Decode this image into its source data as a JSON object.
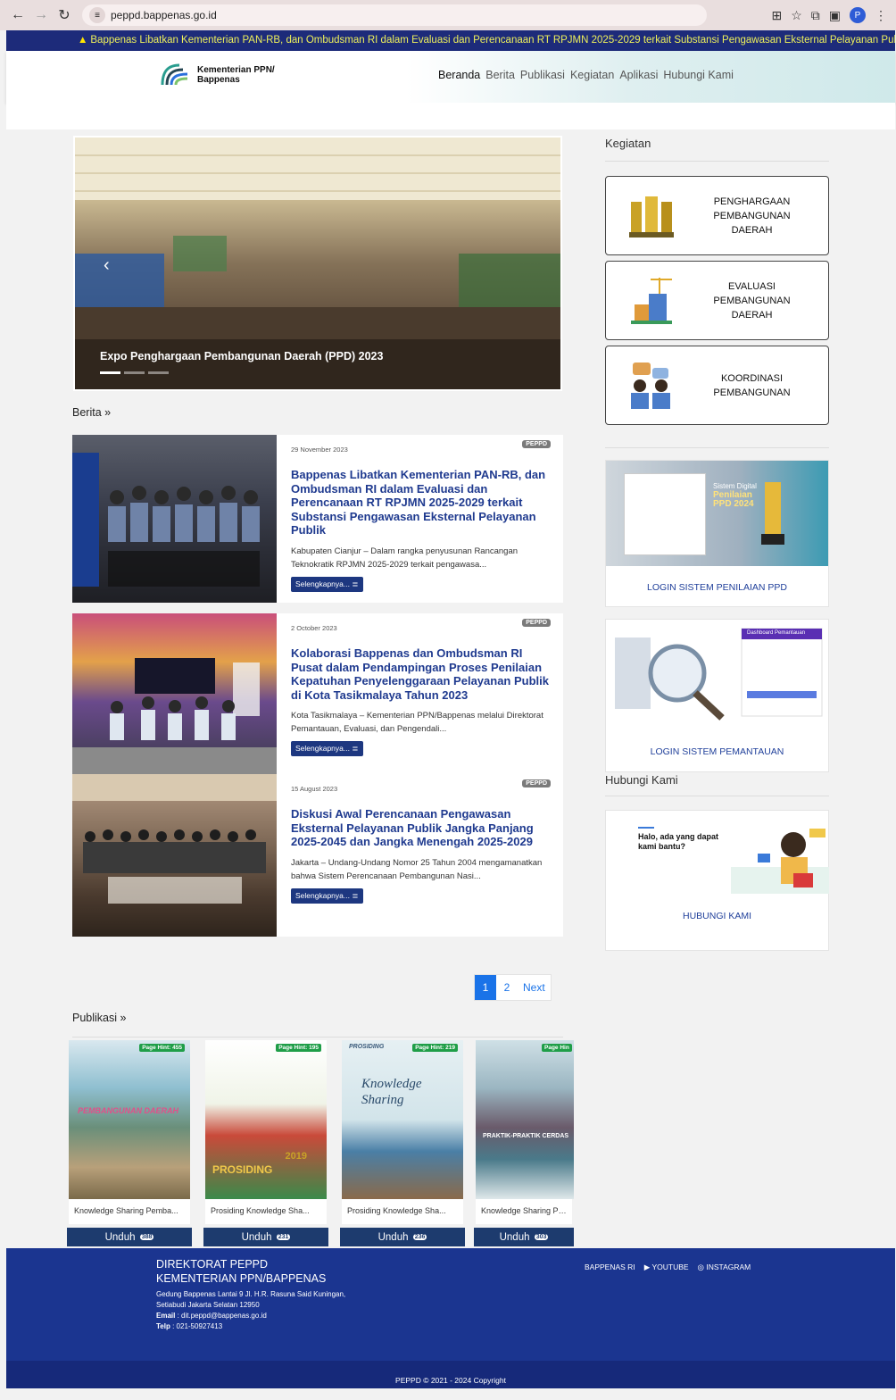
{
  "browser": {
    "url": "peppd.bappenas.go.id"
  },
  "ticker": {
    "text": "Bappenas Libatkan Kementerian PAN-RB, dan Ombudsman RI dalam Evaluasi dan Perencanaan RT RPJMN 2025-2029 terkait Substansi Pengawasan Eksternal Pelayanan Publik"
  },
  "header": {
    "logo_line1": "Kementerian PPN/",
    "logo_line2": "Bappenas",
    "menu": [
      "Beranda",
      "Berita",
      "Publikasi",
      "Kegiatan",
      "Aplikasi",
      "Hubungi Kami"
    ]
  },
  "carousel": {
    "caption": "Expo Penghargaan Pembangunan Daerah (PPD) 2023",
    "slides": 3,
    "active": 1
  },
  "berita": {
    "heading": "Berita »",
    "items": [
      {
        "date": "29 November 2023",
        "tag": "PEPPD",
        "title": "Bappenas Libatkan Kementerian PAN-RB, dan Ombudsman RI dalam Evaluasi dan Perencanaan RT RPJMN 2025-2029 terkait Substansi Pengawasan Eksternal Pelayanan Publik",
        "excerpt": "Kabupaten Cianjur – Dalam rangka penyusunan Rancangan Teknokratik RPJMN 2025-2029 terkait pengawasa...",
        "more": "Selengkapnya..."
      },
      {
        "date": "2 October 2023",
        "tag": "PEPPD",
        "title": "Kolaborasi Bappenas dan Ombudsman RI Pusat dalam Pendampingan Proses Penilaian Kepatuhan Penyelenggaraan Pelayanan Publik di Kota Tasikmalaya Tahun 2023",
        "excerpt": "Kota Tasikmalaya – Kementerian PPN/Bappenas melalui Direktorat Pemantauan, Evaluasi, dan Pengendali...",
        "more": "Selengkapnya..."
      },
      {
        "date": "15 August 2023",
        "tag": "PEPPD",
        "title": "Diskusi Awal Perencanaan Pengawasan Eksternal Pelayanan Publik Jangka Panjang 2025-2045 dan Jangka Menengah 2025-2029",
        "excerpt": "Jakarta – Undang-Undang Nomor 25 Tahun 2004 mengamanatkan bahwa Sistem Perencanaan Pembangunan Nasi...",
        "more": "Selengkapnya..."
      }
    ],
    "pagination": [
      "1",
      "2",
      "Next"
    ]
  },
  "kegiatan": {
    "heading": "Kegiatan",
    "cards": [
      {
        "line1": "PENGHARGAAN",
        "line2": "PEMBANGUNAN",
        "line3": "DAERAH"
      },
      {
        "line1": "EVALUASI",
        "line2": "PEMBANGUNAN",
        "line3": "DAERAH"
      },
      {
        "line1": "KOORDINASI",
        "line2": "PEMBANGUNAN",
        "line3": ""
      }
    ]
  },
  "aplikasi": {
    "login_ppd": "LOGIN SISTEM PENILAIAN PPD",
    "login_ppd_banner_1": "Sistem Digital",
    "login_ppd_banner_2": "Penilaian",
    "login_ppd_banner_3": "PPD 2024",
    "login_pemantauan": "LOGIN SISTEM PEMANTAUAN",
    "dashboard_label": "Dashboard Pemantauan"
  },
  "hubungi": {
    "heading": "Hubungi Kami",
    "prompt_line1": "Halo, ada yang dapat",
    "prompt_line2": "kami bantu?",
    "button": "HUBUNGI KAMI"
  },
  "publikasi": {
    "heading": "Publikasi »",
    "items": [
      {
        "hint": "Page Hint: 455",
        "title": "Knowledge Sharing Pemba...",
        "download": "Unduh",
        "count": "388",
        "cover_text": "PEMBANGUNAN DAERAH"
      },
      {
        "hint": "Page Hint: 195",
        "title": "Prosiding Knowledge Sha...",
        "download": "Unduh",
        "count": "231",
        "cover_text": "PROSIDING",
        "cover_year": "2019"
      },
      {
        "hint": "Page Hint: 219",
        "title": "Prosiding Knowledge Sha...",
        "download": "Unduh",
        "count": "236",
        "cover_text": "Knowledge Sharing",
        "cover_label": "PROSIDING"
      },
      {
        "hint": "Page Hin",
        "title": "Knowledge Sharing Pem",
        "download": "Unduh",
        "count": "303",
        "cover_text": "PRAKTIK-PRAKTIK CERDAS"
      }
    ]
  },
  "footer": {
    "org1": "DIREKTORAT PEPPD",
    "org2": "KEMENTERIAN PPN/BAPPENAS",
    "addr1": "Gedung Bappenas Lantai 9 Jl. H.R. Rasuna Said Kuningan,",
    "addr2": "Setiabudi Jakarta Selatan 12950",
    "email_label": "Email",
    "email": ": dit.peppd@bappenas.go.id",
    "telp_label": "Telp",
    "telp": ": 021-50927413",
    "social": [
      "BAPPENAS RI",
      "YOUTUBE",
      "INSTAGRAM"
    ],
    "copyright": "PEPPD © 2021 - 2024 Copyright"
  },
  "colors": {
    "ticker_bg": "#1d2b7a",
    "link_blue": "#1f3a8f",
    "footer_bg": "#1b3590",
    "pager_active": "#1a73e8"
  }
}
